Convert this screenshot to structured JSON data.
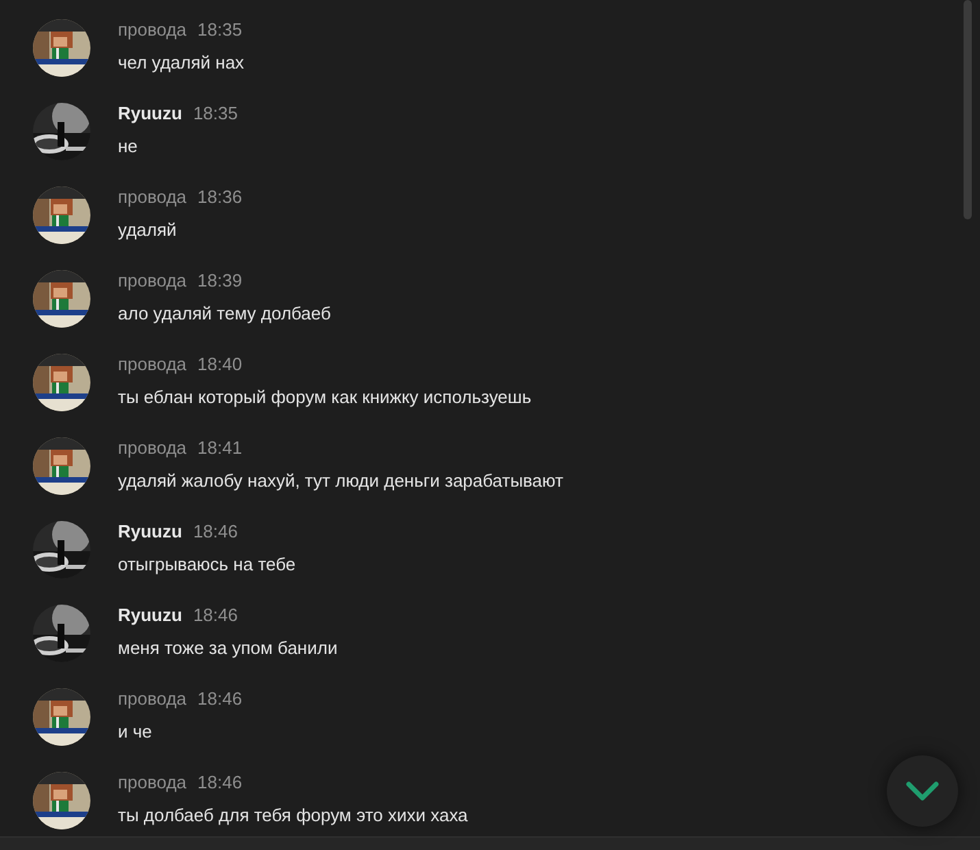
{
  "messages": [
    {
      "author": "провода",
      "kind": "plain",
      "time": "18:35",
      "text": "чел удаляй нах"
    },
    {
      "author": "Ryuuzu",
      "kind": "highlighted",
      "time": "18:35",
      "text": "не"
    },
    {
      "author": "провода",
      "kind": "plain",
      "time": "18:36",
      "text": "удаляй"
    },
    {
      "author": "провода",
      "kind": "plain",
      "time": "18:39",
      "text": "ало удаляй тему долбаеб"
    },
    {
      "author": "провода",
      "kind": "plain",
      "time": "18:40",
      "text": "ты еблан который форум как книжку используешь"
    },
    {
      "author": "провода",
      "kind": "plain",
      "time": "18:41",
      "text": "удаляй жалобу нахуй, тут люди деньги зарабатывают"
    },
    {
      "author": "Ryuuzu",
      "kind": "highlighted",
      "time": "18:46",
      "text": "отыгрываюсь на тебе"
    },
    {
      "author": "Ryuuzu",
      "kind": "highlighted",
      "time": "18:46",
      "text": "меня тоже за упом банили"
    },
    {
      "author": "провода",
      "kind": "plain",
      "time": "18:46",
      "text": "и че"
    },
    {
      "author": "провода",
      "kind": "plain",
      "time": "18:46",
      "text": "ты долбаеб для тебя форум это хихи хаха"
    }
  ]
}
